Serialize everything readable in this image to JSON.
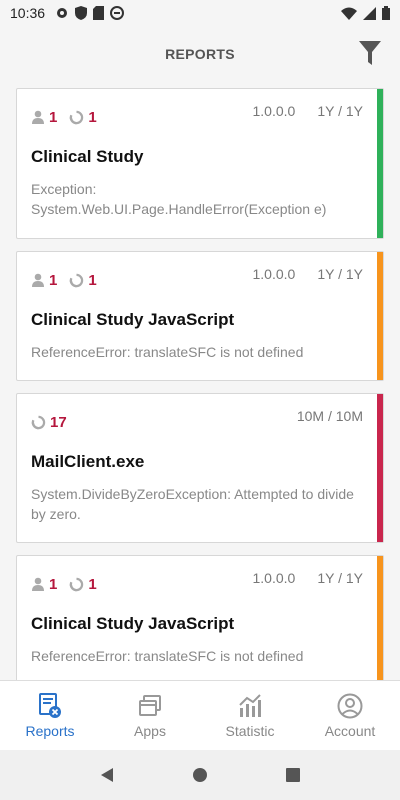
{
  "status_bar": {
    "time": "10:36"
  },
  "header": {
    "title": "REPORTS",
    "filter_icon": "filter-icon"
  },
  "colors": {
    "accent_green": "#2fb15a",
    "accent_orange": "#f7941d",
    "accent_red": "#c9264d",
    "count_red": "#b5173d",
    "active_blue": "#2a72c9"
  },
  "reports": [
    {
      "users": "1",
      "occurrences": "1",
      "version": "1.0.0.0",
      "age": "1Y / 1Y",
      "title": "Clinical Study",
      "description": "Exception: System.Web.UI.Page.HandleError(Exception e)",
      "accent": "green"
    },
    {
      "users": "1",
      "occurrences": "1",
      "version": "1.0.0.0",
      "age": "1Y / 1Y",
      "title": "Clinical Study JavaScript",
      "description": "ReferenceError: translateSFC is not defined",
      "accent": "orange"
    },
    {
      "occurrences": "17",
      "age": "10M / 10M",
      "title": "MailClient.exe",
      "description": "System.DivideByZeroException: Attempted to divide by zero.",
      "accent": "red"
    },
    {
      "users": "1",
      "occurrences": "1",
      "version": "1.0.0.0",
      "age": "1Y / 1Y",
      "title": "Clinical Study JavaScript",
      "description": "ReferenceError: translateSFC is not defined",
      "accent": "orange"
    }
  ],
  "bottom_nav": {
    "reports": "Reports",
    "apps": "Apps",
    "statistic": "Statistic",
    "account": "Account"
  }
}
